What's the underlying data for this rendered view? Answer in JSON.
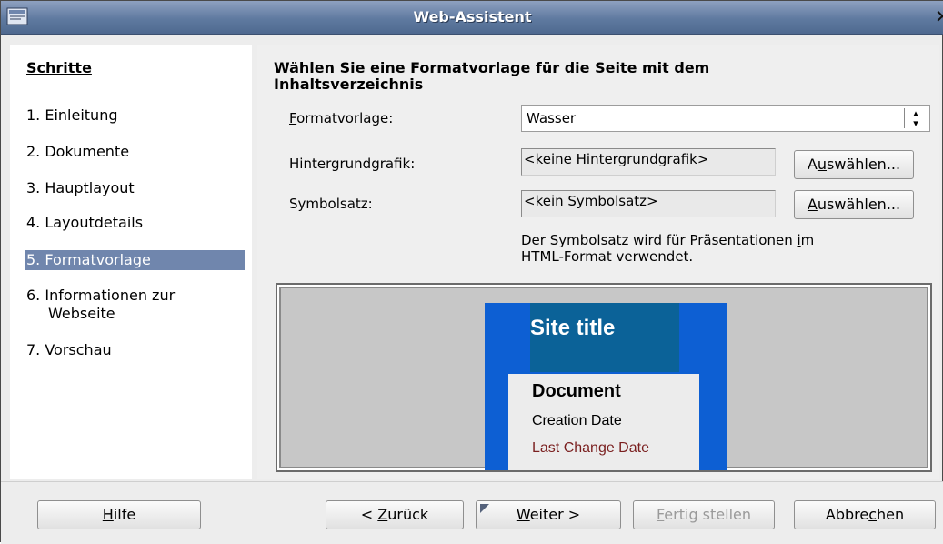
{
  "window": {
    "title": "Web-Assistent",
    "app_icon": "office-app-icon",
    "close_icon": "close-icon"
  },
  "sidebar": {
    "header": "Schritte",
    "steps": [
      {
        "label": "1. Einleitung",
        "selected": false
      },
      {
        "label": "2. Dokumente",
        "selected": false
      },
      {
        "label": "3. Hauptlayout",
        "selected": false
      },
      {
        "label": "4. Layoutdetails",
        "selected": false
      },
      {
        "label": "5. Formatvorlage",
        "selected": true
      },
      {
        "label_line1": "6. Informationen zur",
        "label_line2": "Webseite",
        "selected": false
      },
      {
        "label": "7. Vorschau",
        "selected": false
      }
    ]
  },
  "main": {
    "heading_line1": "Wählen Sie eine Formatvorlage für die Seite mit dem",
    "heading_line2": "Inhaltsverzeichnis",
    "style": {
      "label_mnemonic": "F",
      "label_rest": "ormatvorlage:",
      "value": "Wasser"
    },
    "background": {
      "label": "Hintergrundgrafik:",
      "value": "<keine Hintergrundgrafik>",
      "button_pre": "A",
      "button_mnemonic": "u",
      "button_post": "swählen..."
    },
    "iconset": {
      "label": "Symbolsatz:",
      "value": "<kein Symbolsatz>",
      "button_mnemonic": "A",
      "button_post": "uswählen..."
    },
    "note_line1_pre": "Der Symbolsatz wird für Präsentationen ",
    "note_line1_mnemonic": "i",
    "note_line1_post": "m",
    "note_line2": "HTML-Format verwendet.",
    "preview": {
      "site_title": "Site title",
      "document": "Document",
      "creation_date": "Creation Date",
      "last_change_date": "Last Change Date"
    }
  },
  "buttons": {
    "help_mnemonic": "H",
    "help_rest": "ilfe",
    "back_pre": "< ",
    "back_mnemonic": "Z",
    "back_rest": "urück",
    "next_mnemonic": "W",
    "next_rest": "eiter >",
    "finish_mnemonic": "F",
    "finish_rest": "ertig stellen",
    "finish_enabled": false,
    "cancel_pre": "Abbre",
    "cancel_mnemonic": "c",
    "cancel_post": "hen"
  },
  "colors": {
    "selection": "#7086ad",
    "titlebar": "#5f7aa0",
    "preview_blue": "#0d5fd3",
    "preview_title_box": "#0b6298",
    "last_change": "#7a1f1f"
  }
}
